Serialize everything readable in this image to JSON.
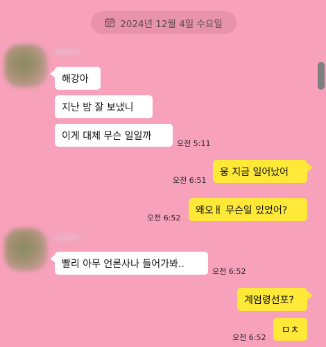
{
  "date_header": {
    "icon": "calendar-icon",
    "text": "2024년 12월 4일 수요일"
  },
  "messages": [
    {
      "text": "해강아",
      "direction": "incoming"
    },
    {
      "text": "지난 밤 잘 보냈니",
      "direction": "incoming"
    },
    {
      "text": "이게 대체 무슨 일일까",
      "direction": "incoming",
      "time": "오전 5:11"
    },
    {
      "text": "웅 지금 일어났어",
      "direction": "outgoing",
      "time": "오전 6:51"
    },
    {
      "text": "왜오ㅐ 무슨일 있었어?",
      "direction": "outgoing",
      "time": "오전 6:52"
    },
    {
      "text": "빨리 아무 언론사나 들어가봐..",
      "direction": "incoming",
      "time": "오전 6:52"
    },
    {
      "text": "계엄령선포?",
      "direction": "outgoing"
    },
    {
      "text": "ㅁㅊ",
      "direction": "outgoing",
      "time": "오전 6:52"
    }
  ],
  "colors": {
    "background": "#f7a1bb",
    "incoming_bubble": "#ffffff",
    "outgoing_bubble": "#fee838",
    "date_pill": "#e992ad"
  }
}
